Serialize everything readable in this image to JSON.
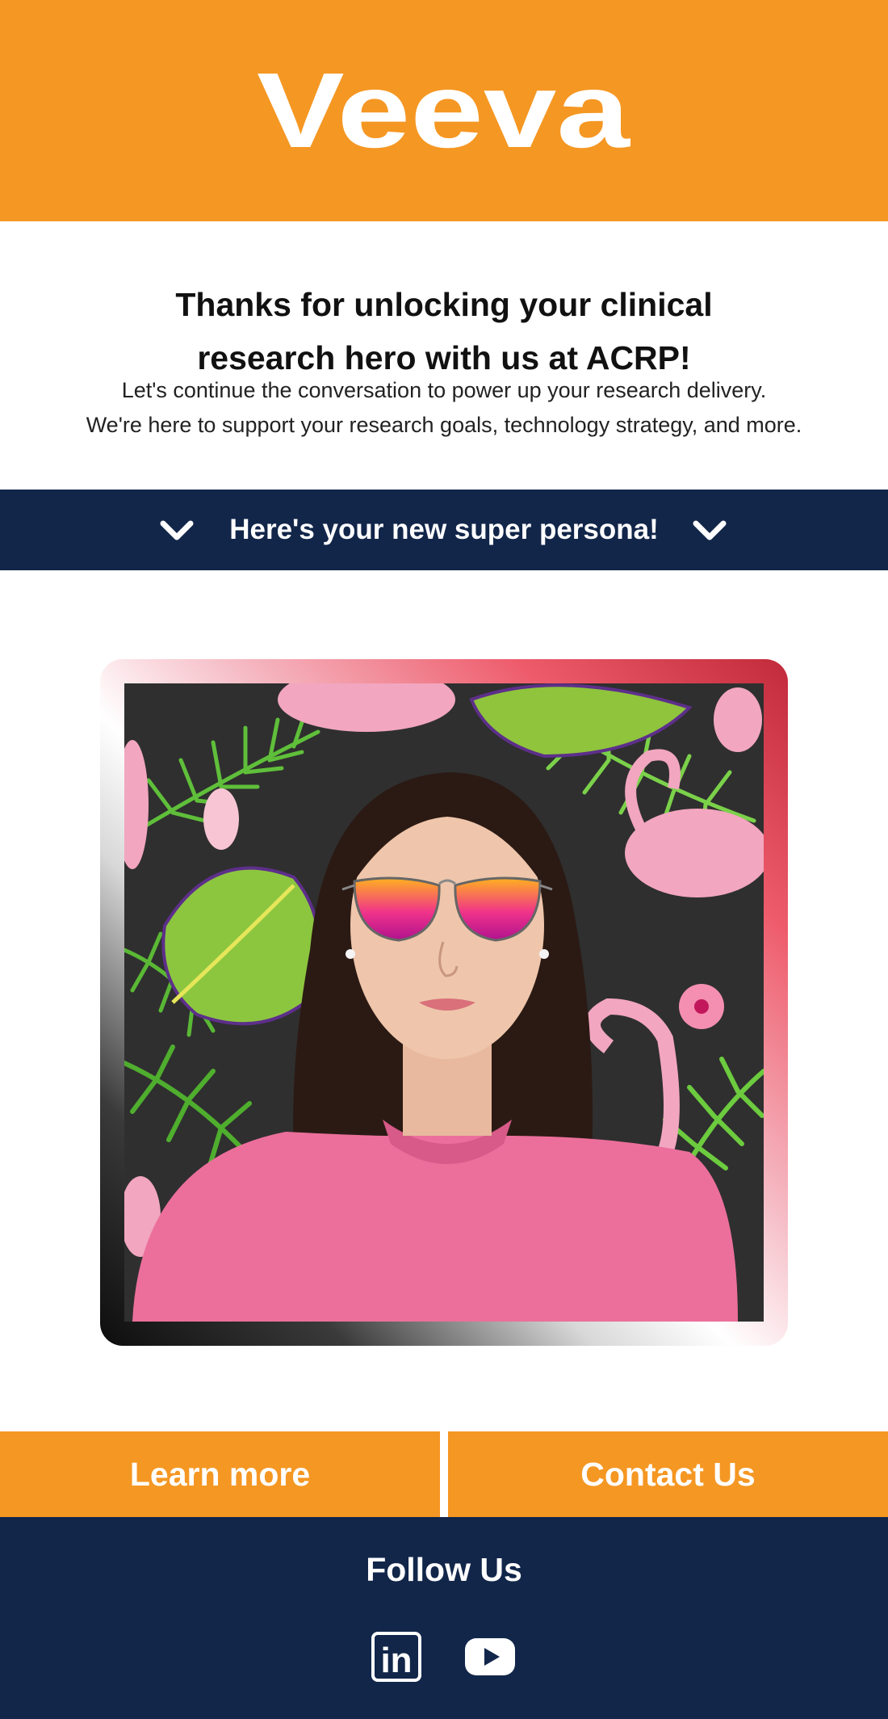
{
  "header": {
    "logo_text": "Veeva",
    "background_color": "#F59723"
  },
  "intro": {
    "heading_line1": "Thanks for unlocking your clinical",
    "heading_line2": "research hero with us at ACRP!",
    "body_line1": "Let's continue the conversation to power up your research delivery.",
    "body_line2": "We're here to support your research goals, technology strategy, and more."
  },
  "banner": {
    "label": "Here's your new super persona!",
    "background_color": "#12264A",
    "left_icon": "chevron-down-icon",
    "right_icon": "chevron-down-icon"
  },
  "persona_image": {
    "subject": "woman with pink sunglasses and pink sweater in front of tropical flamingo background"
  },
  "actions": {
    "learn_more": "Learn more",
    "contact_us": "Contact Us",
    "button_color": "#F59723"
  },
  "footer": {
    "follow_label": "Follow Us",
    "social": [
      {
        "icon": "linkedin-icon",
        "text": "in"
      },
      {
        "icon": "youtube-icon"
      }
    ],
    "background_color": "#12264A"
  }
}
